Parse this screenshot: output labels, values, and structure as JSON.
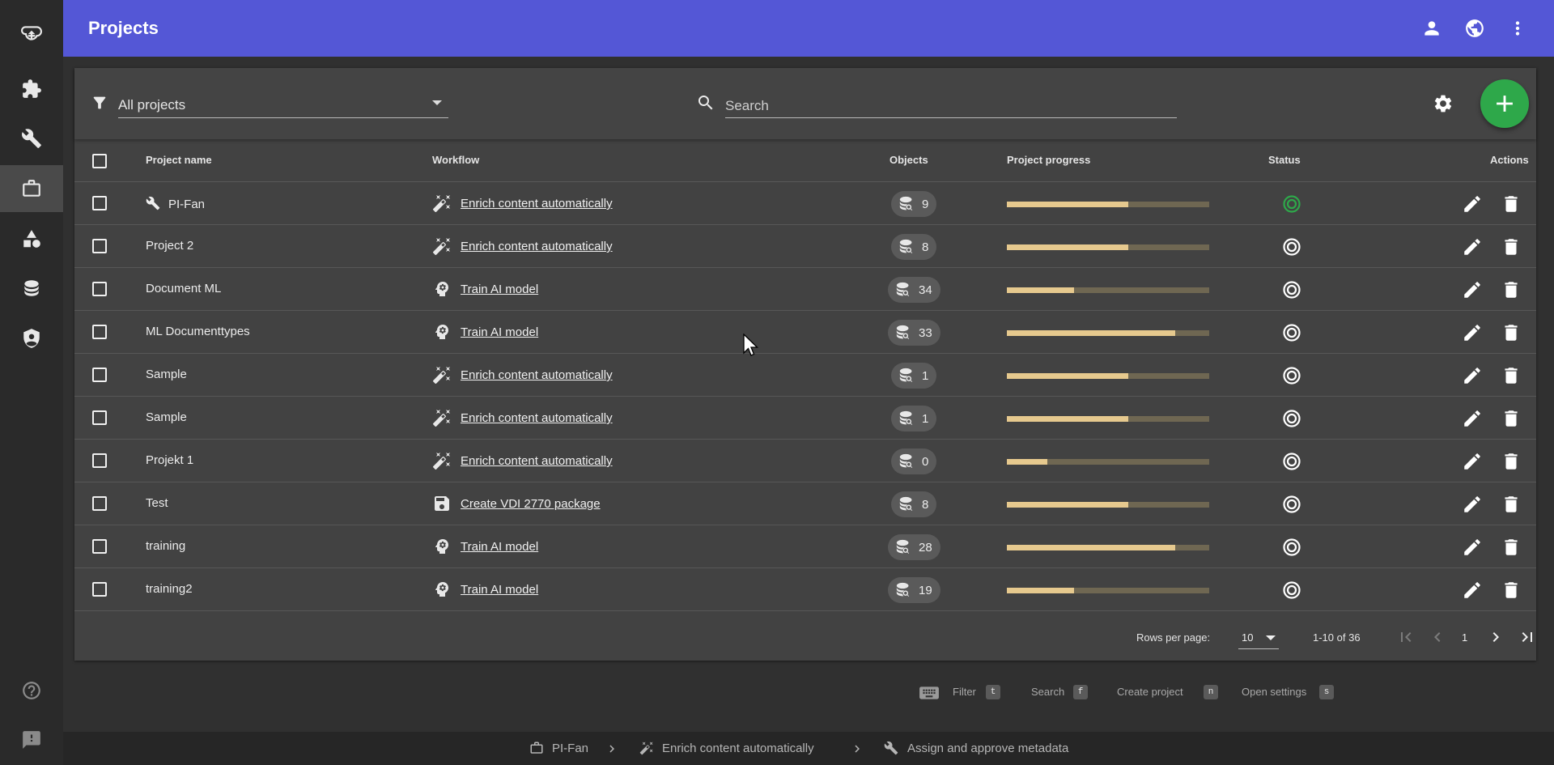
{
  "colors": {
    "topbar": "#5457d6",
    "sidebar": "#2a2a2a",
    "card": "#424242",
    "add_button": "#2ea84a",
    "progress_fill": "#e6c98e",
    "progress_track": "#6f6752",
    "status_active": "#2ea84a"
  },
  "sidebar": {
    "items": [
      {
        "name": "cloud-upload-icon"
      },
      {
        "name": "puzzle-icon"
      },
      {
        "name": "wrench-icon"
      },
      {
        "name": "briefcase-icon",
        "active": true
      },
      {
        "name": "shapes-icon"
      },
      {
        "name": "database-icon"
      },
      {
        "name": "security-icon"
      }
    ],
    "bottom": [
      {
        "name": "help-icon"
      },
      {
        "name": "feedback-icon"
      }
    ]
  },
  "header": {
    "title": "Projects",
    "icons": [
      "account-icon",
      "language-icon",
      "more-vert-icon"
    ]
  },
  "toolbar": {
    "filter_value": "All projects",
    "search_placeholder": "Search"
  },
  "table": {
    "columns": {
      "name": "Project name",
      "workflow": "Workflow",
      "objects": "Objects",
      "progress": "Project progress",
      "status": "Status",
      "actions": "Actions"
    },
    "rows": [
      {
        "name": "PI-Fan",
        "name_icon": "wrench-icon",
        "workflow": "Enrich content automatically",
        "workflow_icon": "magic-wand-icon",
        "objects": "9",
        "progress": 0.6,
        "status": "active"
      },
      {
        "name": "Project 2",
        "workflow": "Enrich content automatically",
        "workflow_icon": "magic-wand-icon",
        "objects": "8",
        "progress": 0.6,
        "status": "inactive"
      },
      {
        "name": "Document ML",
        "workflow": "Train AI model",
        "workflow_icon": "brain-icon",
        "objects": "34",
        "progress": 0.33,
        "status": "inactive"
      },
      {
        "name": "ML Documenttypes",
        "workflow": "Train AI model",
        "workflow_icon": "brain-icon",
        "objects": "33",
        "progress": 0.83,
        "status": "inactive"
      },
      {
        "name": "Sample",
        "workflow": "Enrich content automatically",
        "workflow_icon": "magic-wand-icon",
        "objects": "1",
        "progress": 0.6,
        "status": "inactive"
      },
      {
        "name": "Sample",
        "workflow": "Enrich content automatically",
        "workflow_icon": "magic-wand-icon",
        "objects": "1",
        "progress": 0.6,
        "status": "inactive"
      },
      {
        "name": "Projekt 1",
        "workflow": "Enrich content automatically",
        "workflow_icon": "magic-wand-icon",
        "objects": "0",
        "progress": 0.2,
        "status": "inactive"
      },
      {
        "name": "Test",
        "workflow": "Create VDI 2770 package",
        "workflow_icon": "package-icon",
        "objects": "8",
        "progress": 0.6,
        "status": "inactive"
      },
      {
        "name": "training",
        "workflow": "Train AI model",
        "workflow_icon": "brain-icon",
        "objects": "28",
        "progress": 0.83,
        "status": "inactive"
      },
      {
        "name": "training2",
        "workflow": "Train AI model",
        "workflow_icon": "brain-icon",
        "objects": "19",
        "progress": 0.33,
        "status": "inactive"
      }
    ]
  },
  "pagination": {
    "rows_per_page_label": "Rows per page:",
    "rows_per_page": "10",
    "range": "1-10 of 36",
    "page": "1"
  },
  "shortcuts": [
    {
      "label": "Filter",
      "key": "t"
    },
    {
      "label": "Search",
      "key": "f"
    },
    {
      "label": "Create project",
      "key": "n"
    },
    {
      "label": "Open settings",
      "key": "s"
    }
  ],
  "breadcrumb": [
    {
      "label": "PI-Fan",
      "icon": "briefcase-icon"
    },
    {
      "label": "Enrich content automatically",
      "icon": "magic-wand-icon"
    },
    {
      "label": "Assign and approve metadata",
      "icon": "wrench-icon"
    }
  ]
}
